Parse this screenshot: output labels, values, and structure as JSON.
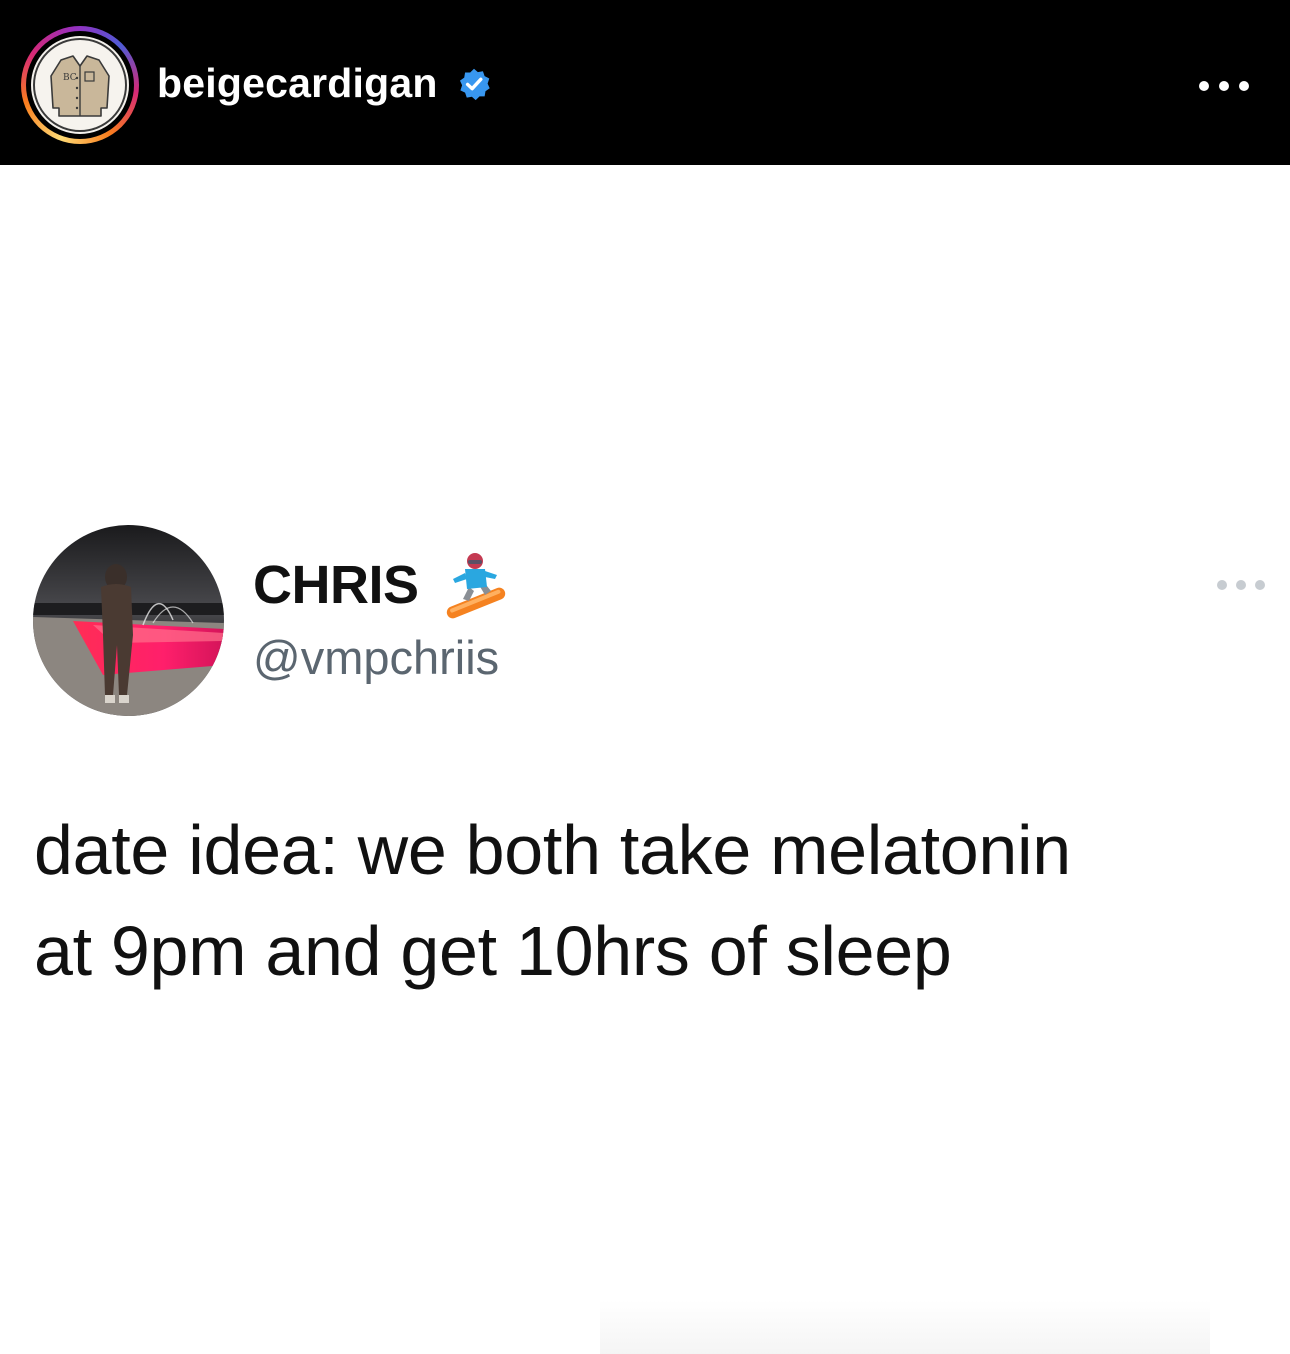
{
  "post_header": {
    "username": "beigecardigan",
    "verified_icon": "verified-badge-icon",
    "more_icon": "more-horizontal-icon",
    "avatar_icon": "cardigan-logo-icon",
    "avatar_logo_text": "BC",
    "colors": {
      "header_bg": "#000000",
      "username": "#ffffff",
      "verified_badge": "#3897f0"
    }
  },
  "tweet": {
    "display_name": "CHRIS",
    "name_emoji_icon": "snowboarder-icon",
    "handle": "@vmpchriis",
    "more_icon": "more-horizontal-icon",
    "text_lines": [
      "date idea: we both take melatonin",
      "at 9pm and get 10hrs of sleep"
    ],
    "colors": {
      "name": "#111111",
      "handle": "#5b6670",
      "text": "#111111",
      "more_dots": "#c7ccd1"
    }
  }
}
